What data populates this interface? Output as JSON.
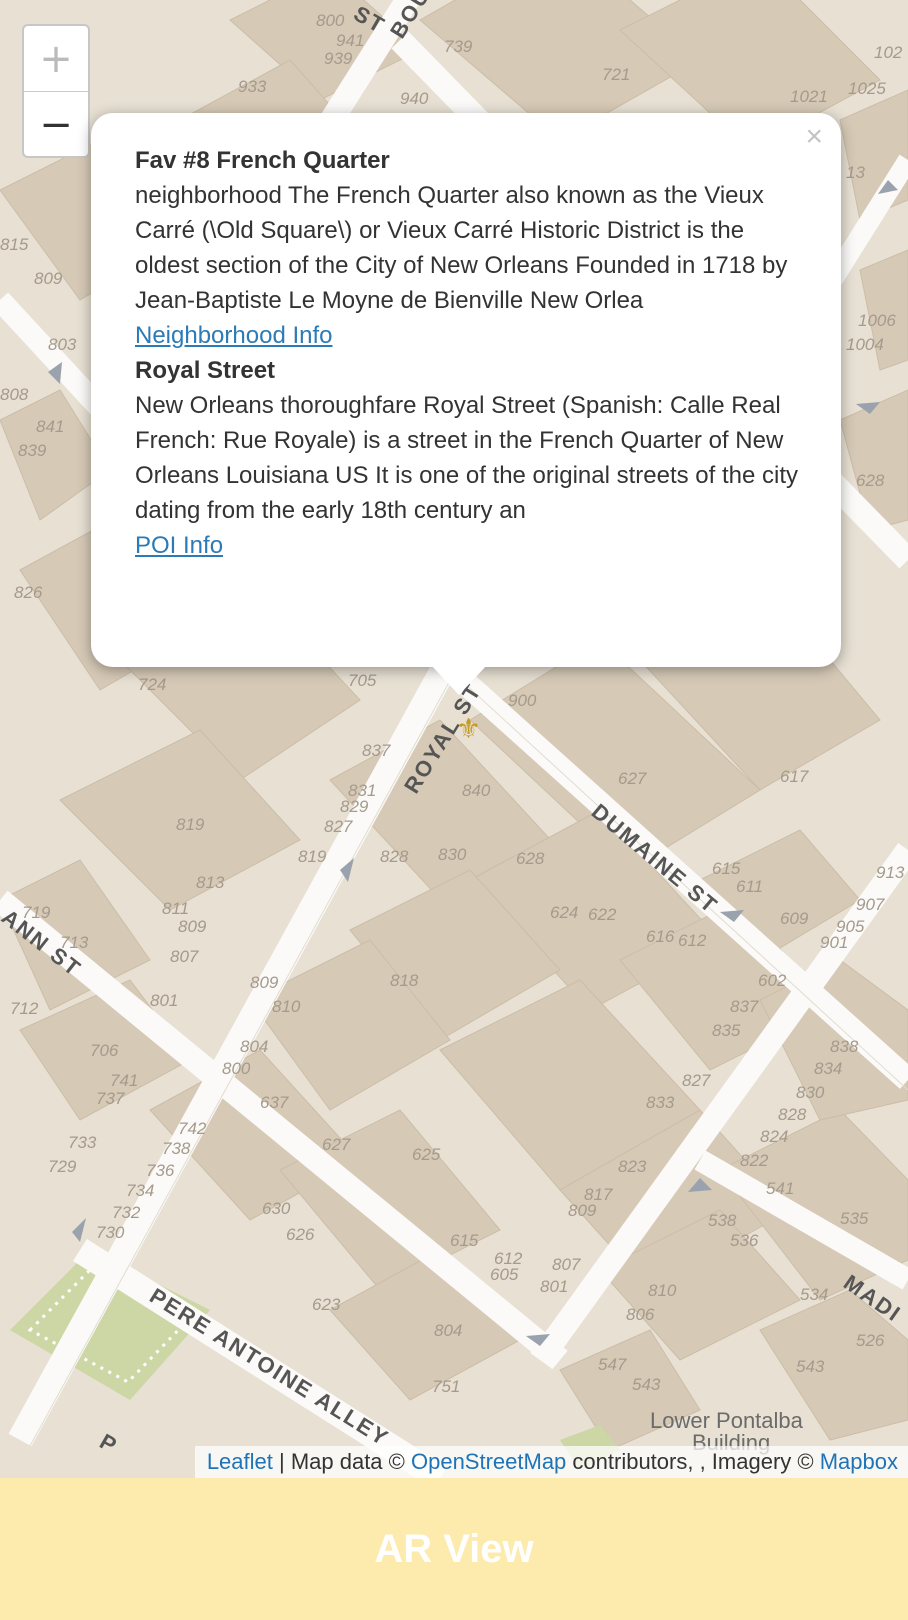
{
  "popup": {
    "close_symbol": "×",
    "neighborhood_title": "Fav #8 French Quarter",
    "neighborhood_text": "neighborhood The French Quarter also known as the Vieux Carré (\\Old Square\\) or Vieux Carré Historic District is the oldest section of the City of New Orleans Founded in 1718 by Jean-Baptiste Le Moyne de Bienville New Orlea",
    "neighborhood_link": "Neighborhood Info",
    "poi_title": "Royal Street",
    "poi_text": "New Orleans thoroughfare Royal Street (Spanish: Calle Real French: Rue Royale) is a street in the French Quarter of New Orleans Louisiana US It is one of the original streets of the city dating from the early 18th century an",
    "poi_link": "POI Info"
  },
  "zoom": {
    "in_label": "+",
    "out_label": "−"
  },
  "map": {
    "street_labels": [
      "BOU",
      "ST",
      "ROYAL ST",
      "DUMAINE ST",
      "ANN ST",
      "PERE ANTOINE ALLEY",
      "MADI",
      "P"
    ],
    "building_labels": [
      "Lower Pontalba",
      "Building"
    ],
    "house_numbers": [
      "800",
      "941",
      "939",
      "933",
      "739",
      "721",
      "1021",
      "1025",
      "102",
      "940",
      "815",
      "809",
      "803",
      "808",
      "841",
      "839",
      "826",
      "724",
      "705",
      "900",
      "837",
      "840",
      "627",
      "617",
      "831",
      "829",
      "827",
      "819",
      "813",
      "811",
      "809",
      "807",
      "801",
      "819",
      "828",
      "830",
      "628",
      "624",
      "622",
      "616",
      "612",
      "615",
      "611",
      "609",
      "907",
      "905",
      "901",
      "913",
      "719",
      "713",
      "712",
      "706",
      "741",
      "737",
      "733",
      "729",
      "818",
      "809",
      "810",
      "804",
      "800",
      "637",
      "742",
      "738",
      "736",
      "734",
      "732",
      "730",
      "627",
      "625",
      "630",
      "626",
      "623",
      "615",
      "612",
      "605",
      "807",
      "801",
      "804",
      "751",
      "833",
      "827",
      "823",
      "817",
      "809",
      "837",
      "835",
      "602",
      "838",
      "834",
      "830",
      "828",
      "824",
      "822",
      "541",
      "535",
      "538",
      "536",
      "810",
      "806",
      "547",
      "543",
      "534",
      "526",
      "543",
      "1006",
      "1004",
      "628",
      "13"
    ],
    "marker_icon": "fleur-de-lis-icon",
    "colors": {
      "land": "#e7e0d3",
      "building": "#d6c9b6",
      "road": "#fbfaf8",
      "park": "#cdd7a6"
    }
  },
  "attribution": {
    "leaflet": "Leaflet",
    "sep": " | Map data © ",
    "osm": "OpenStreetMap",
    "mid": " contributors, , Imagery © ",
    "mapbox": "Mapbox"
  },
  "ar_button": {
    "label": "AR View"
  }
}
